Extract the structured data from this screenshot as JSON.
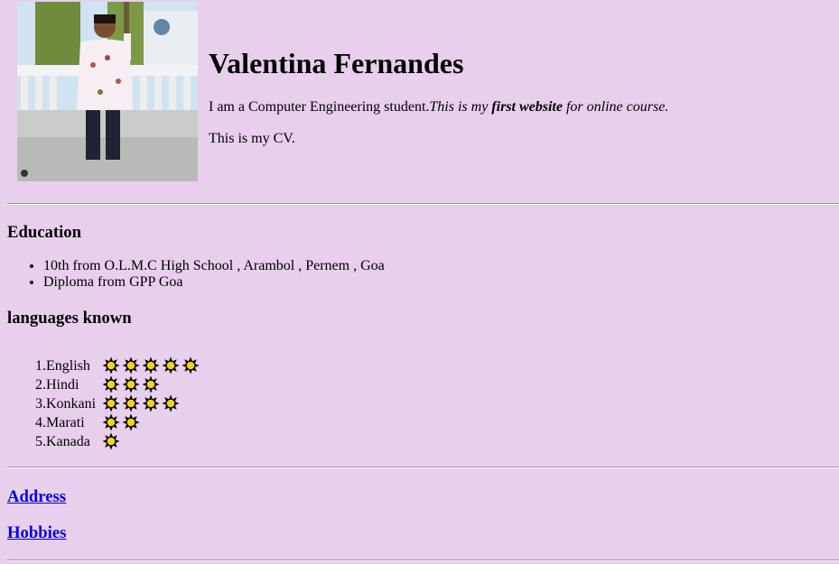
{
  "profile": {
    "name": "Valentina Fernandes",
    "intro_plain": "I am a Computer Engineering student.",
    "intro_italic_1": "This is my ",
    "intro_bold_italic": "first website",
    "intro_italic_2": " for online course.",
    "cv_line": "This is my CV."
  },
  "education": {
    "heading": "Education",
    "items": [
      "10th from O.L.M.C High School , Arambol , Pernem , Goa",
      "Diploma from GPP Goa"
    ]
  },
  "languages": {
    "heading": "languages known",
    "items": [
      {
        "num": "1.",
        "name": "English",
        "rating": 5
      },
      {
        "num": "2.",
        "name": "Hindi",
        "rating": 3
      },
      {
        "num": "3.",
        "name": "Konkani",
        "rating": 4
      },
      {
        "num": "4.",
        "name": "Marati",
        "rating": 2
      },
      {
        "num": "5.",
        "name": "Kanada",
        "rating": 1
      }
    ]
  },
  "links": {
    "address": "Address",
    "hobbies": "Hobbies"
  },
  "colors": {
    "background": "#e8cfec",
    "link": "#0000ee",
    "star_fill": "#f2d21a",
    "star_outline": "#000000"
  }
}
